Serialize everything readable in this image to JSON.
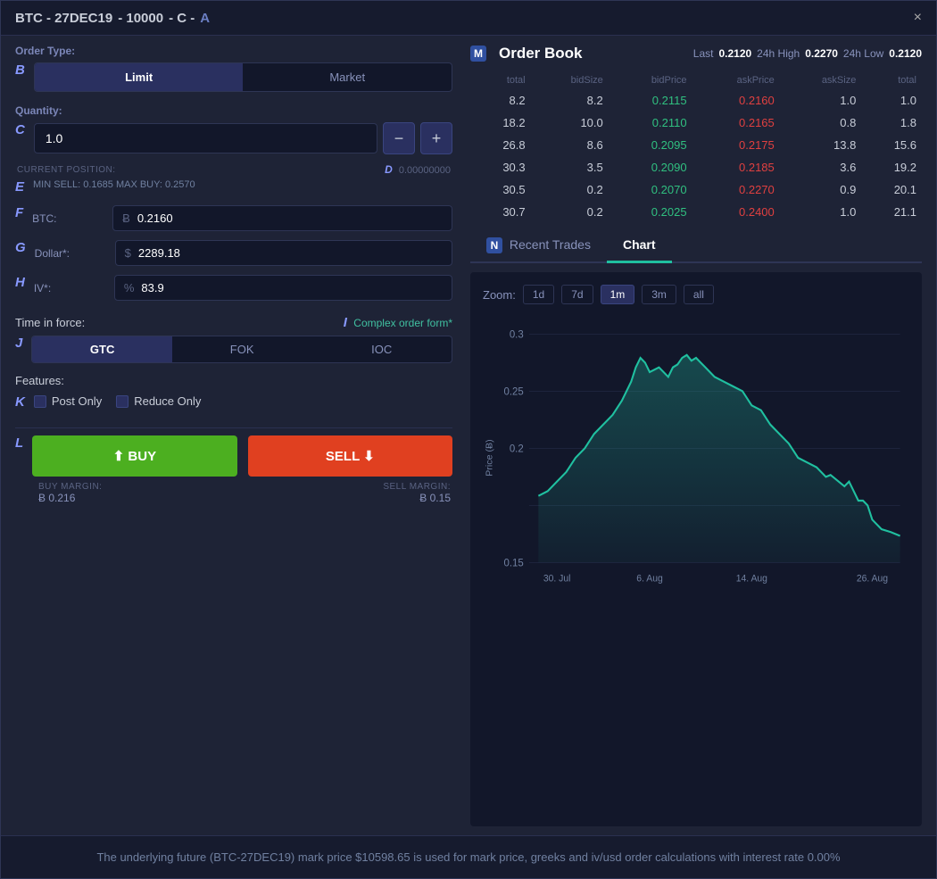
{
  "titleBar": {
    "title": "BTC - 27DEC19",
    "params": "- 10000",
    "type": "- C -",
    "badge": "A",
    "closeBtn": "×"
  },
  "orderForm": {
    "orderTypeLabel": "Order Type:",
    "orderTypes": [
      "Limit",
      "Market"
    ],
    "activeOrderType": "Limit",
    "quantityLabel": "Quantity:",
    "quantityValue": "1.0",
    "decrementBtn": "−",
    "incrementBtn": "+",
    "currentPositionLabel": "CURRENT POSITION:",
    "currentPositionValue": "0.00000000",
    "minMaxLabel": "MIN SELL: 0.1685  MAX BUY: 0.2570",
    "btcLabel": "BTC:",
    "btcIcon": "Ƀ",
    "btcValue": "0.2160",
    "dollarLabel": "Dollar*:",
    "dollarIcon": "$",
    "dollarValue": "2289.18",
    "ivLabel": "IV*:",
    "ivIcon": "%",
    "ivValue": "83.9",
    "timeInForceLabel": "Time in force:",
    "complexOrderLink": "Complex order form*",
    "tifOptions": [
      "GTC",
      "FOK",
      "IOC"
    ],
    "activeTif": "GTC",
    "featuresLabel": "Features:",
    "postOnlyLabel": "Post Only",
    "reduceOnlyLabel": "Reduce Only",
    "buyBtn": "⬆ BUY",
    "sellBtn": "SELL ⬇",
    "buyMarginLabel": "BUY MARGIN:",
    "buyMarginValue": "Ƀ 0.216",
    "sellMarginLabel": "SELL MARGIN:",
    "sellMarginValue": "Ƀ 0.15",
    "letters": {
      "B": "B",
      "C": "C",
      "D": "D",
      "E": "E",
      "F": "F",
      "G": "G",
      "H": "H",
      "I": "I",
      "J": "J",
      "K": "K",
      "L": "L"
    }
  },
  "orderBook": {
    "mBadge": "M",
    "title": "Order Book",
    "lastLabel": "Last",
    "lastValue": "0.2120",
    "highLabel": "24h High",
    "highValue": "0.2270",
    "lowLabel": "24h Low",
    "lowValue": "0.2120",
    "columns": [
      "total",
      "bidSize",
      "bidPrice",
      "askPrice",
      "askSize",
      "total"
    ],
    "rows": [
      {
        "total1": "8.2",
        "bidSize": "8.2",
        "bidPrice": "0.2115",
        "askPrice": "0.2160",
        "askSize": "1.0",
        "total2": "1.0"
      },
      {
        "total1": "18.2",
        "bidSize": "10.0",
        "bidPrice": "0.2110",
        "askPrice": "0.2165",
        "askSize": "0.8",
        "total2": "1.8"
      },
      {
        "total1": "26.8",
        "bidSize": "8.6",
        "bidPrice": "0.2095",
        "askPrice": "0.2175",
        "askSize": "13.8",
        "total2": "15.6"
      },
      {
        "total1": "30.3",
        "bidSize": "3.5",
        "bidPrice": "0.2090",
        "askPrice": "0.2185",
        "askSize": "3.6",
        "total2": "19.2"
      },
      {
        "total1": "30.5",
        "bidSize": "0.2",
        "bidPrice": "0.2070",
        "askPrice": "0.2270",
        "askSize": "0.9",
        "total2": "20.1"
      },
      {
        "total1": "30.7",
        "bidSize": "0.2",
        "bidPrice": "0.2025",
        "askPrice": "0.2400",
        "askSize": "1.0",
        "total2": "21.1"
      }
    ]
  },
  "tabs": {
    "recentTradesLabel": "Recent Trades",
    "chartLabel": "Chart",
    "nBadge": "N",
    "activeTab": "Chart"
  },
  "chart": {
    "zoomLabel": "Zoom:",
    "zoomOptions": [
      "1d",
      "7d",
      "1m",
      "3m",
      "all"
    ],
    "activeZoom": "1m",
    "yAxisLabels": [
      "0.3",
      "0.25",
      "0.2",
      "0.15"
    ],
    "xAxisLabels": [
      "30. Jul",
      "6. Aug",
      "14. Aug",
      "26. Aug"
    ],
    "yAxisTitle": "Price (Ƀ)"
  },
  "bottomNotice": "The underlying future (BTC-27DEC19) mark price $10598.65 is used for mark price, greeks and iv/usd order calculations with interest rate 0.00%"
}
